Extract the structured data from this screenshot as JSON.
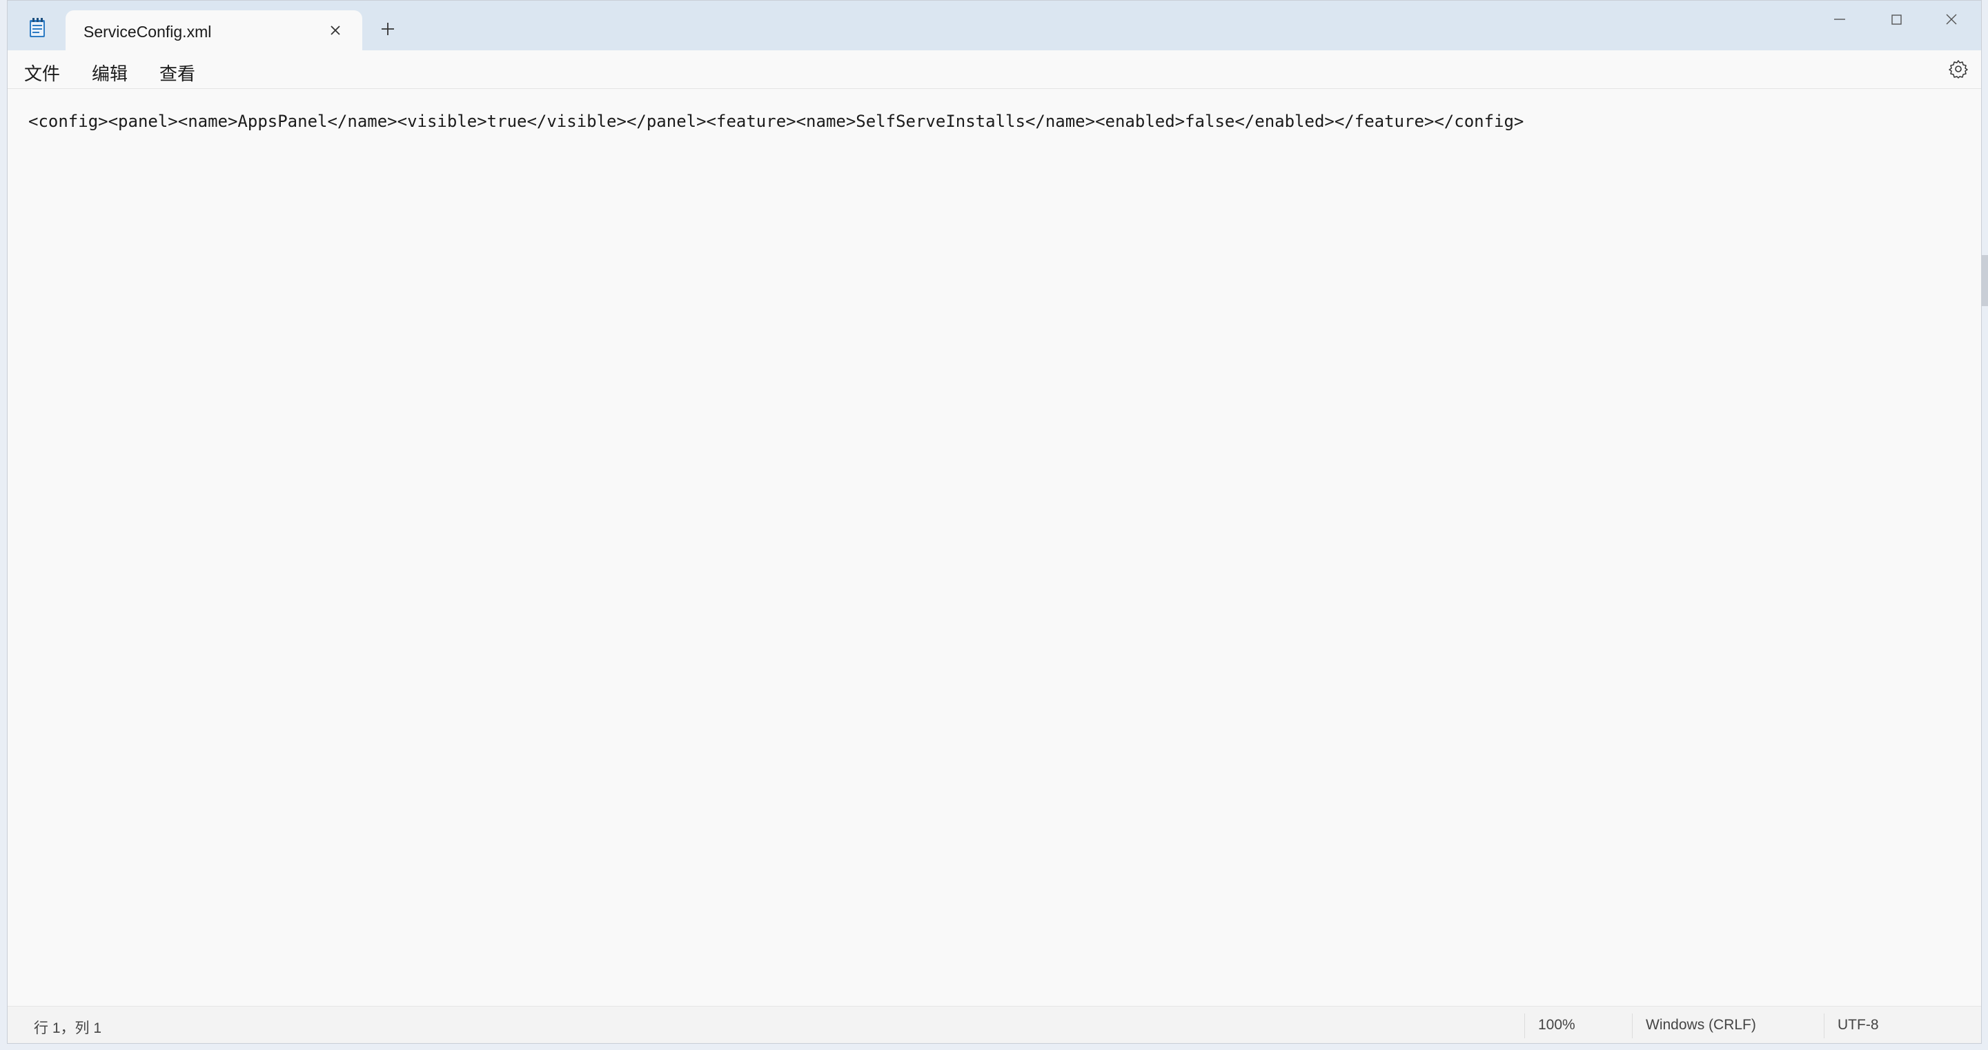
{
  "tab": {
    "title": "ServiceConfig.xml"
  },
  "menu": {
    "file": "文件",
    "edit": "编辑",
    "view": "查看"
  },
  "editor": {
    "content": "<config><panel><name>AppsPanel</name><visible>true</visible></panel><feature><name>SelfServeInstalls</name><enabled>false</enabled></feature></config>"
  },
  "status": {
    "position": "行 1，列 1",
    "zoom": "100%",
    "line_ending": "Windows (CRLF)",
    "encoding": "UTF-8"
  },
  "icons": {
    "app": "notepad-icon",
    "close_tab": "close-icon",
    "new_tab": "plus-icon",
    "minimize": "minimize-icon",
    "maximize": "maximize-icon",
    "close_window": "close-icon",
    "settings": "gear-icon"
  },
  "colors": {
    "titlebar": "#dbe6f1",
    "background": "#f9f9f9",
    "text": "#1b1b1b"
  }
}
